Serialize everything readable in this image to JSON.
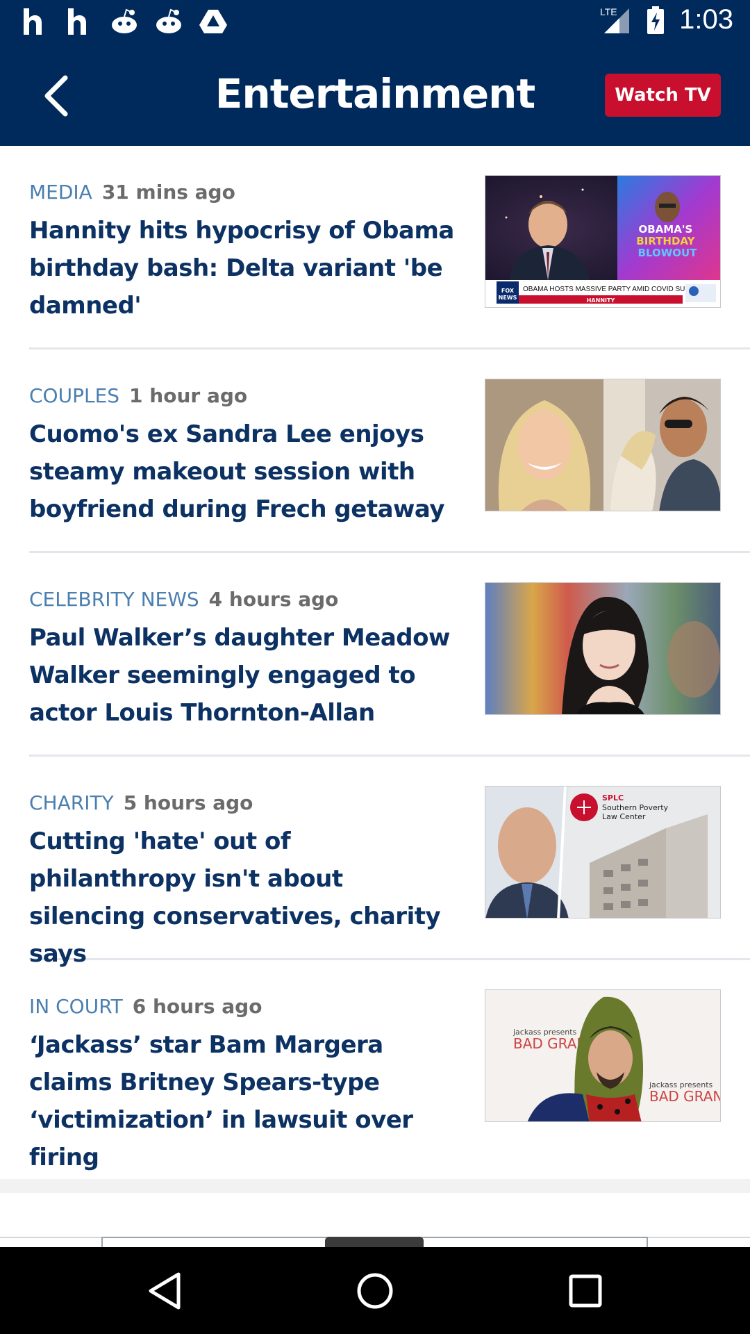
{
  "status_bar": {
    "time": "1:03",
    "network": "LTE",
    "notification_icons": [
      "h-app-icon",
      "h-app-icon",
      "reddit-icon",
      "reddit-icon",
      "drive-icon"
    ]
  },
  "header": {
    "title": "Entertainment",
    "watch_tv_label": "Watch TV"
  },
  "articles": [
    {
      "category": "MEDIA",
      "time": "31 mins ago",
      "headline": "Hannity hits hypocrisy of Obama birthday bash: Delta variant 'be damned'",
      "thumb_caption": "OBAMA'S BIRTHDAY BLOWOUT",
      "thumb_ticker": "OBAMA HOSTS MASSIVE PARTY AMID COVID SURGE",
      "thumb_show": "HANNITY"
    },
    {
      "category": "COUPLES",
      "time": "1 hour ago",
      "headline": "Cuomo's ex Sandra Lee enjoys steamy makeout session with boyfriend during Frech getaway"
    },
    {
      "category": "CELEBRITY NEWS",
      "time": "4 hours ago",
      "headline": "Paul Walker’s daughter Meadow Walker seemingly engaged to actor Louis Thornton-Allan"
    },
    {
      "category": "CHARITY",
      "time": "5 hours ago",
      "headline": "Cutting 'hate' out of philanthropy isn't about silencing conservatives, charity says",
      "thumb_org": "SPLC",
      "thumb_org_name": "Southern Poverty Law Center"
    },
    {
      "category": "IN COURT",
      "time": "6 hours ago",
      "headline": "‘Jackass’ star Bam Margera claims Britney Spears-type ‘victimization’ in lawsuit over firing",
      "thumb_backdrop": "jackass presents BAD GRANDPA"
    }
  ],
  "colors": {
    "brand_navy": "#002a5c",
    "watch_tv_red": "#c8102e",
    "category_blue": "#4a7fb0",
    "headline_navy": "#0c3163"
  }
}
